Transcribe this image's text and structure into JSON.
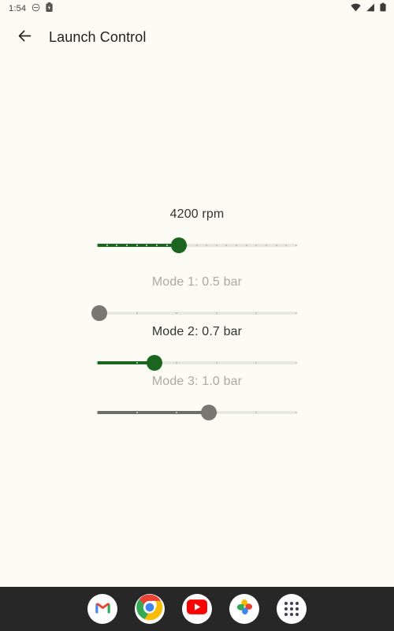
{
  "statusbar": {
    "time": "1:54",
    "left_icons": [
      {
        "name": "do-not-disturb-icon"
      },
      {
        "name": "battery-saver-icon"
      }
    ],
    "right_icons": [
      {
        "name": "wifi-icon"
      },
      {
        "name": "cellular-signal-icon"
      },
      {
        "name": "battery-icon"
      }
    ]
  },
  "appbar": {
    "back_label": "back-arrow",
    "title": "Launch Control"
  },
  "colors": {
    "background": "#fcfcf5",
    "accent_green": "#1b661f",
    "disabled_grey": "#787771",
    "track_inactive": "#e6e8dd",
    "dock_background": "#272727",
    "text_enabled": "#33332f",
    "text_disabled": "#aaaaa2"
  },
  "sliders": [
    {
      "id": "launch-rpm",
      "label": "4200 rpm",
      "value": 4200,
      "unit": "rpm",
      "percent": 41,
      "enabled": true,
      "ticks": 21
    },
    {
      "id": "mode-1-boost",
      "label": "Mode 1: 0.5 bar",
      "value": 0.5,
      "unit": "bar",
      "percent": 1,
      "enabled": false,
      "ticks": 6
    },
    {
      "id": "mode-2-boost",
      "label": "Mode 2: 0.7 bar",
      "value": 0.7,
      "unit": "bar",
      "percent": 29,
      "enabled": true,
      "ticks": 6
    },
    {
      "id": "mode-3-boost",
      "label": "Mode 3: 1.0 bar",
      "value": 1.0,
      "unit": "bar",
      "percent": 56,
      "enabled": false,
      "ticks": 6
    }
  ],
  "dock": {
    "apps": [
      {
        "name": "gmail-icon",
        "label": "Gmail"
      },
      {
        "name": "chrome-icon",
        "label": "Chrome"
      },
      {
        "name": "youtube-icon",
        "label": "YouTube"
      },
      {
        "name": "google-photos-icon",
        "label": "Photos"
      },
      {
        "name": "app-drawer-icon",
        "label": "All apps"
      }
    ]
  }
}
